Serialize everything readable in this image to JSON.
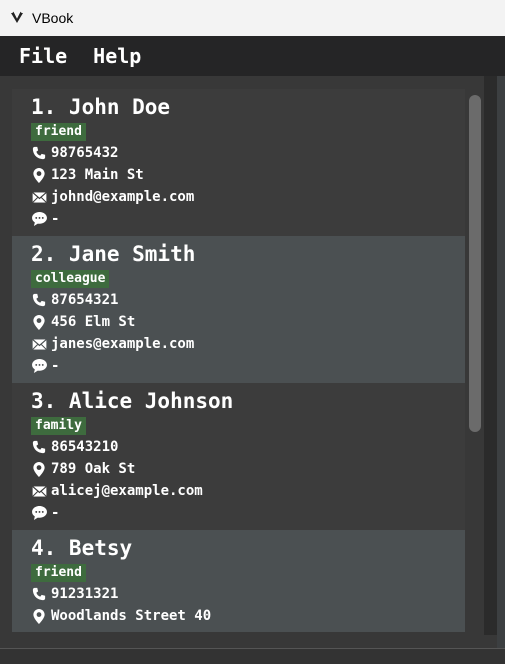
{
  "window": {
    "title": "VBook"
  },
  "menu": {
    "file": "File",
    "help": "Help"
  },
  "contacts": [
    {
      "name": "1. John Doe",
      "tag": "friend",
      "phone": "98765432",
      "address": "123 Main St",
      "email": "johnd@example.com",
      "remark": "-"
    },
    {
      "name": "2. Jane Smith",
      "tag": "colleague",
      "phone": "87654321",
      "address": "456 Elm St",
      "email": "janes@example.com",
      "remark": "-"
    },
    {
      "name": "3. Alice Johnson",
      "tag": "family",
      "phone": "86543210",
      "address": "789 Oak St",
      "email": "alicej@example.com",
      "remark": "-"
    },
    {
      "name": "4. Betsy",
      "tag": "friend",
      "phone": "91231321",
      "address": "Woodlands Street 40",
      "email": "",
      "remark": ""
    }
  ],
  "colors": {
    "tag_bg": "#3e6b3e",
    "card_alt": "#4b5052",
    "card": "#3c3c3c"
  },
  "icons": {
    "phone": "phone-icon",
    "address": "location-pin-icon",
    "email": "envelope-icon",
    "remark": "speech-bubble-icon"
  }
}
